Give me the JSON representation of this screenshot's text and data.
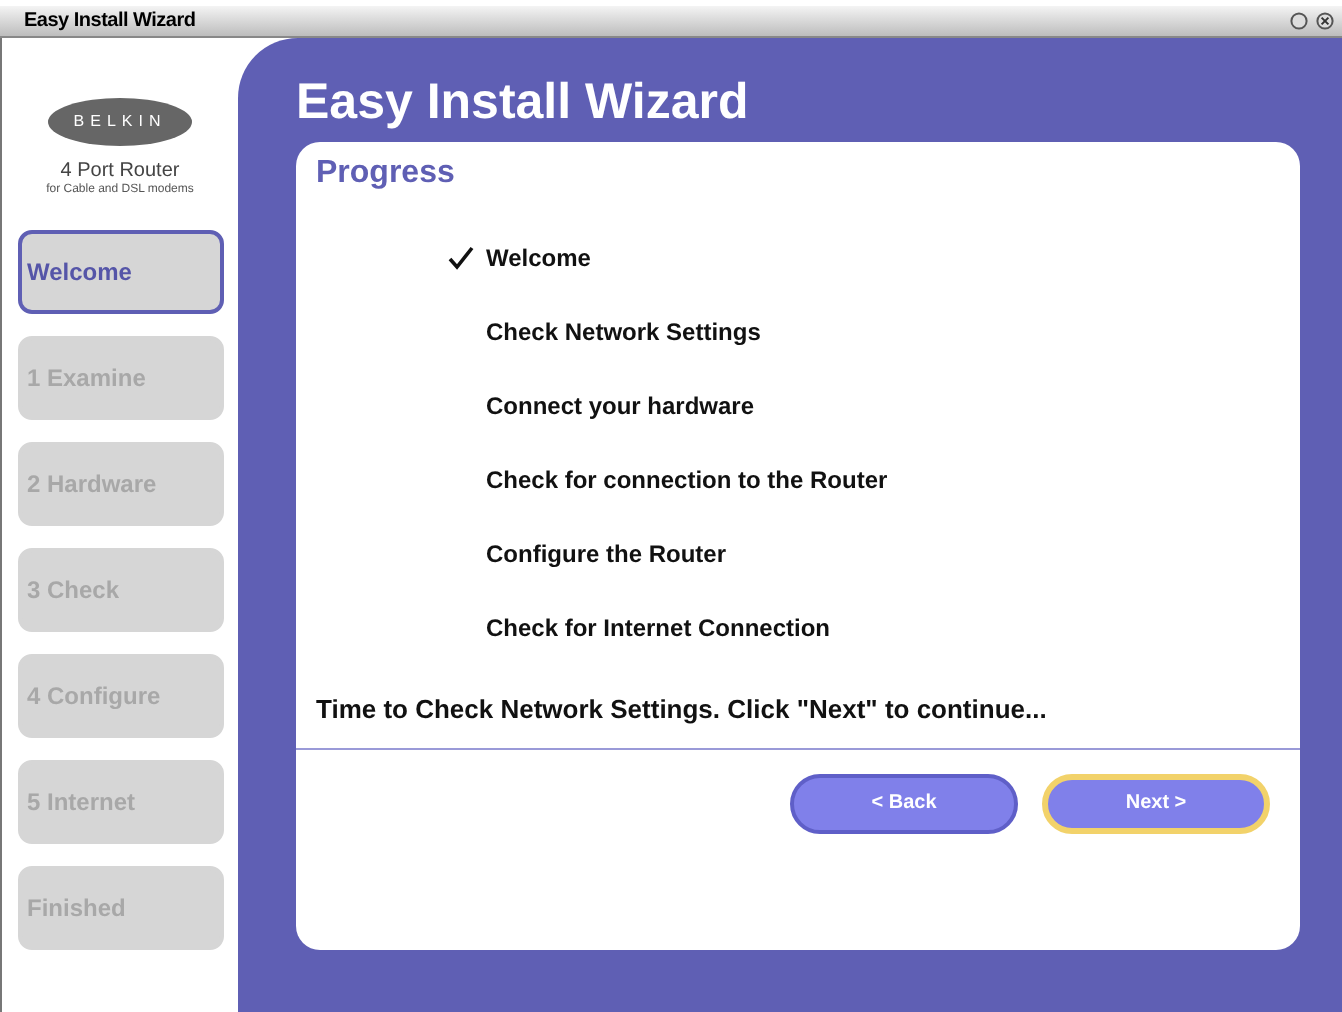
{
  "window": {
    "title": "Easy Install Wizard"
  },
  "brand": {
    "logo": "BELKIN",
    "product": "4 Port Router",
    "subtitle": "for Cable and DSL modems"
  },
  "sidebar": {
    "items": [
      {
        "label": "Welcome",
        "selected": true
      },
      {
        "label": "1 Examine",
        "selected": false
      },
      {
        "label": "2 Hardware",
        "selected": false
      },
      {
        "label": "3 Check",
        "selected": false
      },
      {
        "label": "4 Configure",
        "selected": false
      },
      {
        "label": "5 Internet",
        "selected": false
      },
      {
        "label": "Finished",
        "selected": false
      }
    ]
  },
  "heading": "Easy Install Wizard",
  "panel": {
    "title": "Progress",
    "steps": [
      {
        "label": "Welcome",
        "checked": true
      },
      {
        "label": "Check Network Settings",
        "checked": false
      },
      {
        "label": "Connect your hardware",
        "checked": false
      },
      {
        "label": "Check for connection to the Router",
        "checked": false
      },
      {
        "label": "Configure the Router",
        "checked": false
      },
      {
        "label": "Check for Internet Connection",
        "checked": false
      }
    ],
    "message": "Time to Check Network Settings. Click \"Next\" to continue...",
    "buttons": [
      {
        "label": "< Back",
        "focused": false
      },
      {
        "label": "Next >",
        "focused": true
      }
    ]
  }
}
